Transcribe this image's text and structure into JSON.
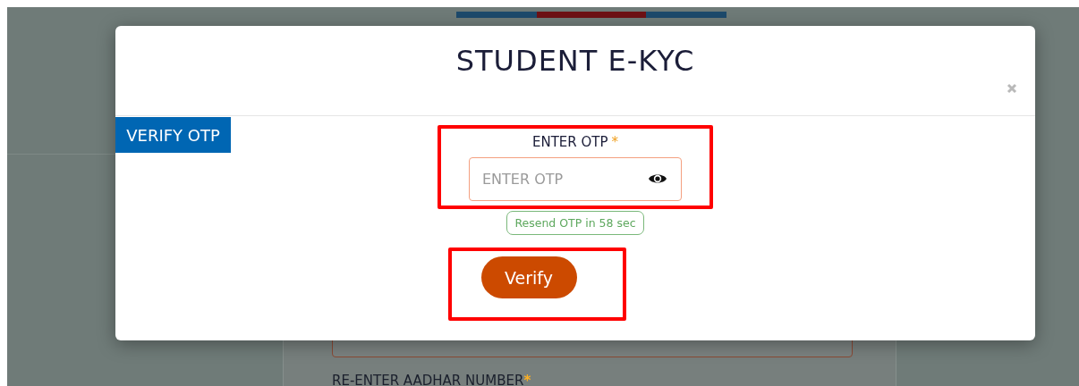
{
  "background_form": {
    "field_label": "RE-ENTER AADHAR NUMBER",
    "required_mark": "*"
  },
  "modal": {
    "title": "STUDENT E-KYC",
    "section_tag": "VERIFY OTP",
    "otp_field": {
      "label": "ENTER OTP",
      "required_mark": "*",
      "placeholder": "ENTER OTP"
    },
    "resend_note": "Resend OTP in 58 sec",
    "verify_button": "Verify"
  }
}
